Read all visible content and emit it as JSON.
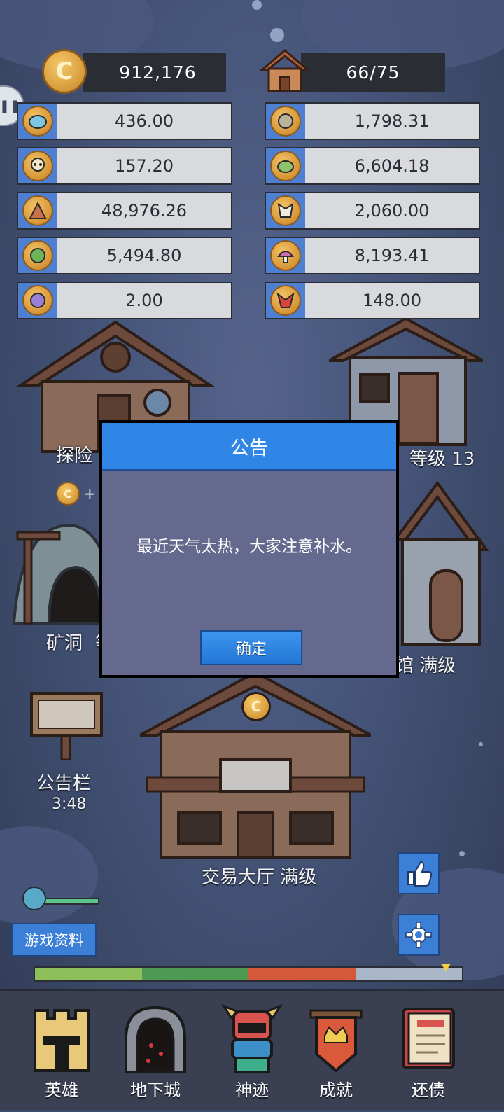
{
  "resources_top": {
    "gold": "912,176",
    "housing": "66/75",
    "gold_icon": "C"
  },
  "resources": {
    "left": [
      {
        "icon": "slime-icon",
        "value": "436.00"
      },
      {
        "icon": "skull-icon",
        "value": "157.20"
      },
      {
        "icon": "treant-icon",
        "value": "48,976.26"
      },
      {
        "icon": "orc-icon",
        "value": "5,494.80"
      },
      {
        "icon": "imp-icon",
        "value": "2.00"
      }
    ],
    "right": [
      {
        "icon": "zombie-icon",
        "value": "1,798.31"
      },
      {
        "icon": "goblin-icon",
        "value": "6,604.18"
      },
      {
        "icon": "wolf-icon",
        "value": "2,060.00"
      },
      {
        "icon": "mushroom-icon",
        "value": "8,193.41"
      },
      {
        "icon": "dragon-icon",
        "value": "148.00"
      }
    ]
  },
  "buildings": {
    "explore": "探险",
    "level_right": "等级 13",
    "coin_plus": "+",
    "mine": "矿洞",
    "mine_suffix": "等",
    "tavern": "馆 满级",
    "board": "公告栏",
    "board_timer": "3:48",
    "trade": "交易大厅 满级",
    "trade_sign": "C"
  },
  "modal": {
    "title": "公告",
    "message": "最近天气太热，大家注意补水。",
    "confirm": "确定"
  },
  "buttons": {
    "info": "游戏资料"
  },
  "nav": [
    {
      "label": "英雄",
      "icon": "castle-icon"
    },
    {
      "label": "地下城",
      "icon": "dungeon-icon"
    },
    {
      "label": "神迹",
      "icon": "totem-icon"
    },
    {
      "label": "成就",
      "icon": "banner-icon"
    },
    {
      "label": "还债",
      "icon": "book-icon"
    }
  ],
  "colors": {
    "modal_header": "#2f86e6",
    "modal_body": "#65698e",
    "cell_icon_bg": "#4e7fd1",
    "button_blue": "#3b7fd6"
  }
}
